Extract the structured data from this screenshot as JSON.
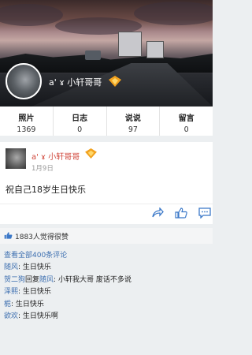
{
  "profile": {
    "name": "a' ɤ 小轩哥哥"
  },
  "stats": [
    {
      "label": "照片",
      "value": "1369"
    },
    {
      "label": "日志",
      "value": "0"
    },
    {
      "label": "说说",
      "value": "97"
    },
    {
      "label": "留言",
      "value": "0"
    }
  ],
  "post": {
    "author": "a' ɤ 小轩哥哥",
    "date": "1月9日",
    "text": "祝自己18岁生日快乐",
    "actions": [
      "share-icon",
      "thumbs-up-icon",
      "comment-icon"
    ]
  },
  "likes": {
    "text": "1883人觉得很赞"
  },
  "comments": {
    "view_all": "查看全部400条评论",
    "items": [
      {
        "name": "随风",
        "sep": ": ",
        "text": "生日快乐",
        "reply_to": ""
      },
      {
        "name": "贺二狗",
        "sep": ": ",
        "text": "小轩我大哥 废话不多说",
        "reply_to": "随风"
      },
      {
        "name": "泽熙",
        "sep": ": ",
        "text": "生日快乐",
        "reply_to": ""
      },
      {
        "name": "栀",
        "sep": ": ",
        "text": "生日快乐",
        "reply_to": ""
      },
      {
        "name": "欲欢",
        "sep": ": ",
        "text": "生日快乐啊",
        "reply_to": ""
      }
    ],
    "reply_word": "回复"
  },
  "colors": {
    "accent_red": "#d0463a",
    "link_blue": "#3d6fb0",
    "vip_orange": "#f2a21f"
  }
}
